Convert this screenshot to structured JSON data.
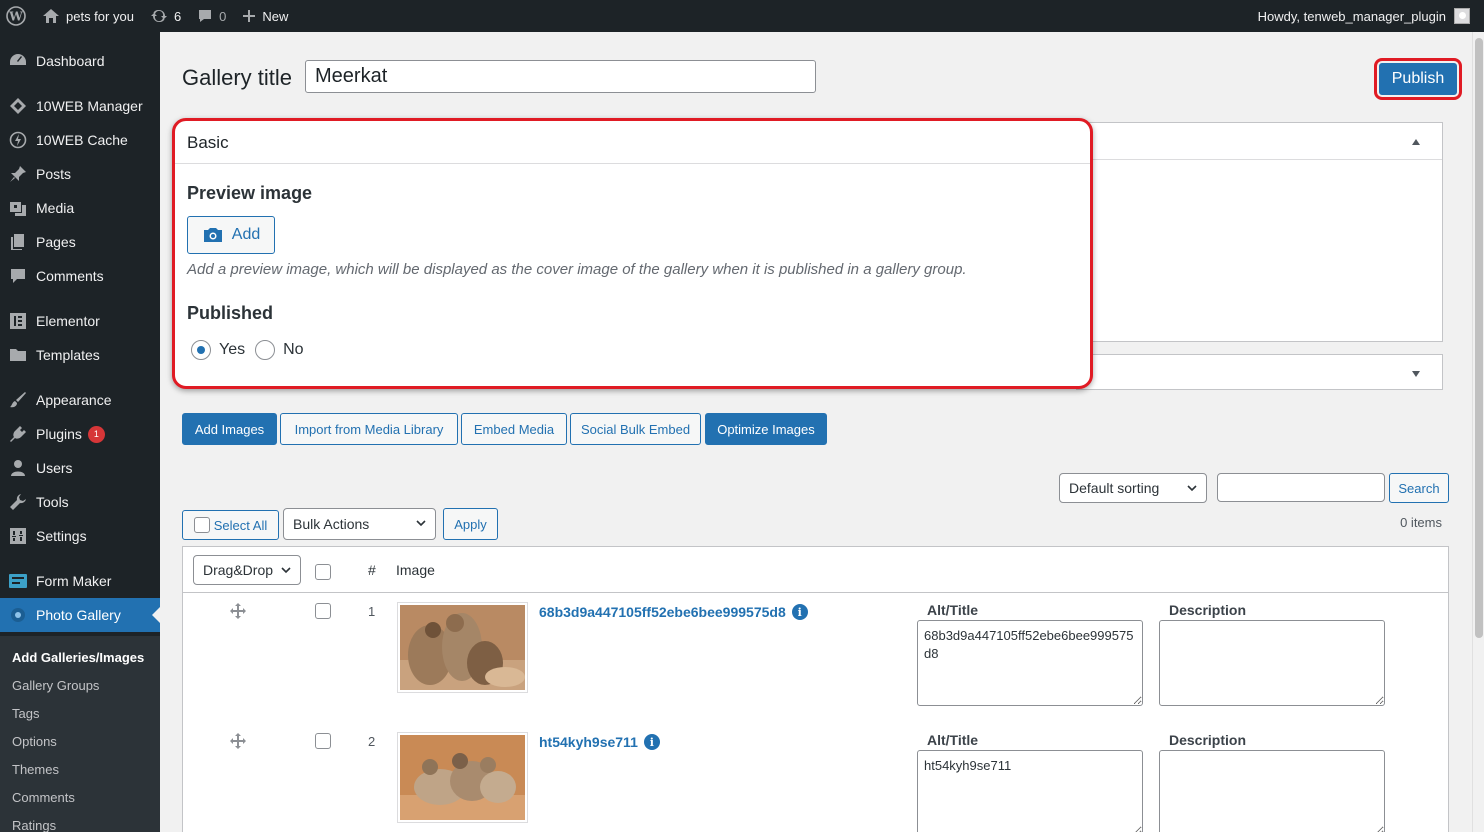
{
  "admin_bar": {
    "site_name": "pets for you",
    "updates_count": "6",
    "comments_count": "0",
    "new_label": "New",
    "greeting": "Howdy, tenweb_manager_plugin"
  },
  "sidebar": {
    "items": [
      {
        "label": "Dashboard",
        "icon": "dashboard-icon"
      },
      {
        "label": "10WEB Manager",
        "icon": "10web-icon"
      },
      {
        "label": "10WEB Cache",
        "icon": "cache-icon"
      },
      {
        "label": "Posts",
        "icon": "pin-icon"
      },
      {
        "label": "Media",
        "icon": "media-icon"
      },
      {
        "label": "Pages",
        "icon": "pages-icon"
      },
      {
        "label": "Comments",
        "icon": "comment-icon"
      },
      {
        "label": "Elementor",
        "icon": "elementor-icon"
      },
      {
        "label": "Templates",
        "icon": "folder-icon"
      },
      {
        "label": "Appearance",
        "icon": "brush-icon"
      },
      {
        "label": "Plugins",
        "icon": "plugin-icon",
        "badge": "1"
      },
      {
        "label": "Users",
        "icon": "users-icon"
      },
      {
        "label": "Tools",
        "icon": "wrench-icon"
      },
      {
        "label": "Settings",
        "icon": "settings-icon"
      },
      {
        "label": "Form Maker",
        "icon": "form-icon"
      },
      {
        "label": "Photo Gallery",
        "icon": "photo-gallery-icon"
      }
    ],
    "submenu": [
      {
        "label": "Add Galleries/Images"
      },
      {
        "label": "Gallery Groups"
      },
      {
        "label": "Tags"
      },
      {
        "label": "Options"
      },
      {
        "label": "Themes"
      },
      {
        "label": "Comments"
      },
      {
        "label": "Ratings"
      }
    ]
  },
  "page": {
    "gallery_title_label": "Gallery title",
    "gallery_title_value": "Meerkat",
    "publish_label": "Publish"
  },
  "basic_panel": {
    "heading": "Basic",
    "preview_image_label": "Preview image",
    "add_label": "Add",
    "preview_desc": "Add a preview image, which will be displayed as the cover image of the gallery when it is published in a gallery group.",
    "published_label": "Published",
    "yes_label": "Yes",
    "no_label": "No",
    "published_value": "Yes"
  },
  "toolbar": {
    "add_images": "Add Images",
    "import_media": "Import from Media Library",
    "embed_media": "Embed Media",
    "social_bulk": "Social Bulk Embed",
    "optimize": "Optimize Images",
    "sorting": "Default sorting",
    "search_label": "Search",
    "select_all": "Select All",
    "bulk_actions": "Bulk Actions",
    "apply": "Apply",
    "items_count": "0 items"
  },
  "table": {
    "drag_select": "Drag&Drop",
    "col_num": "#",
    "col_image": "Image",
    "alt_label": "Alt/Title",
    "desc_label": "Description",
    "rows": [
      {
        "num": "1",
        "name": "68b3d9a447105ff52ebe6bee999575d8",
        "alt": "68b3d9a447105ff52ebe6bee999575d8",
        "description": ""
      },
      {
        "num": "2",
        "name": "ht54kyh9se711",
        "alt": "ht54kyh9se711",
        "description": ""
      }
    ]
  },
  "colors": {
    "accent": "#2271b1",
    "highlight": "#e01b24",
    "sidebar_bg": "#1d2327"
  }
}
